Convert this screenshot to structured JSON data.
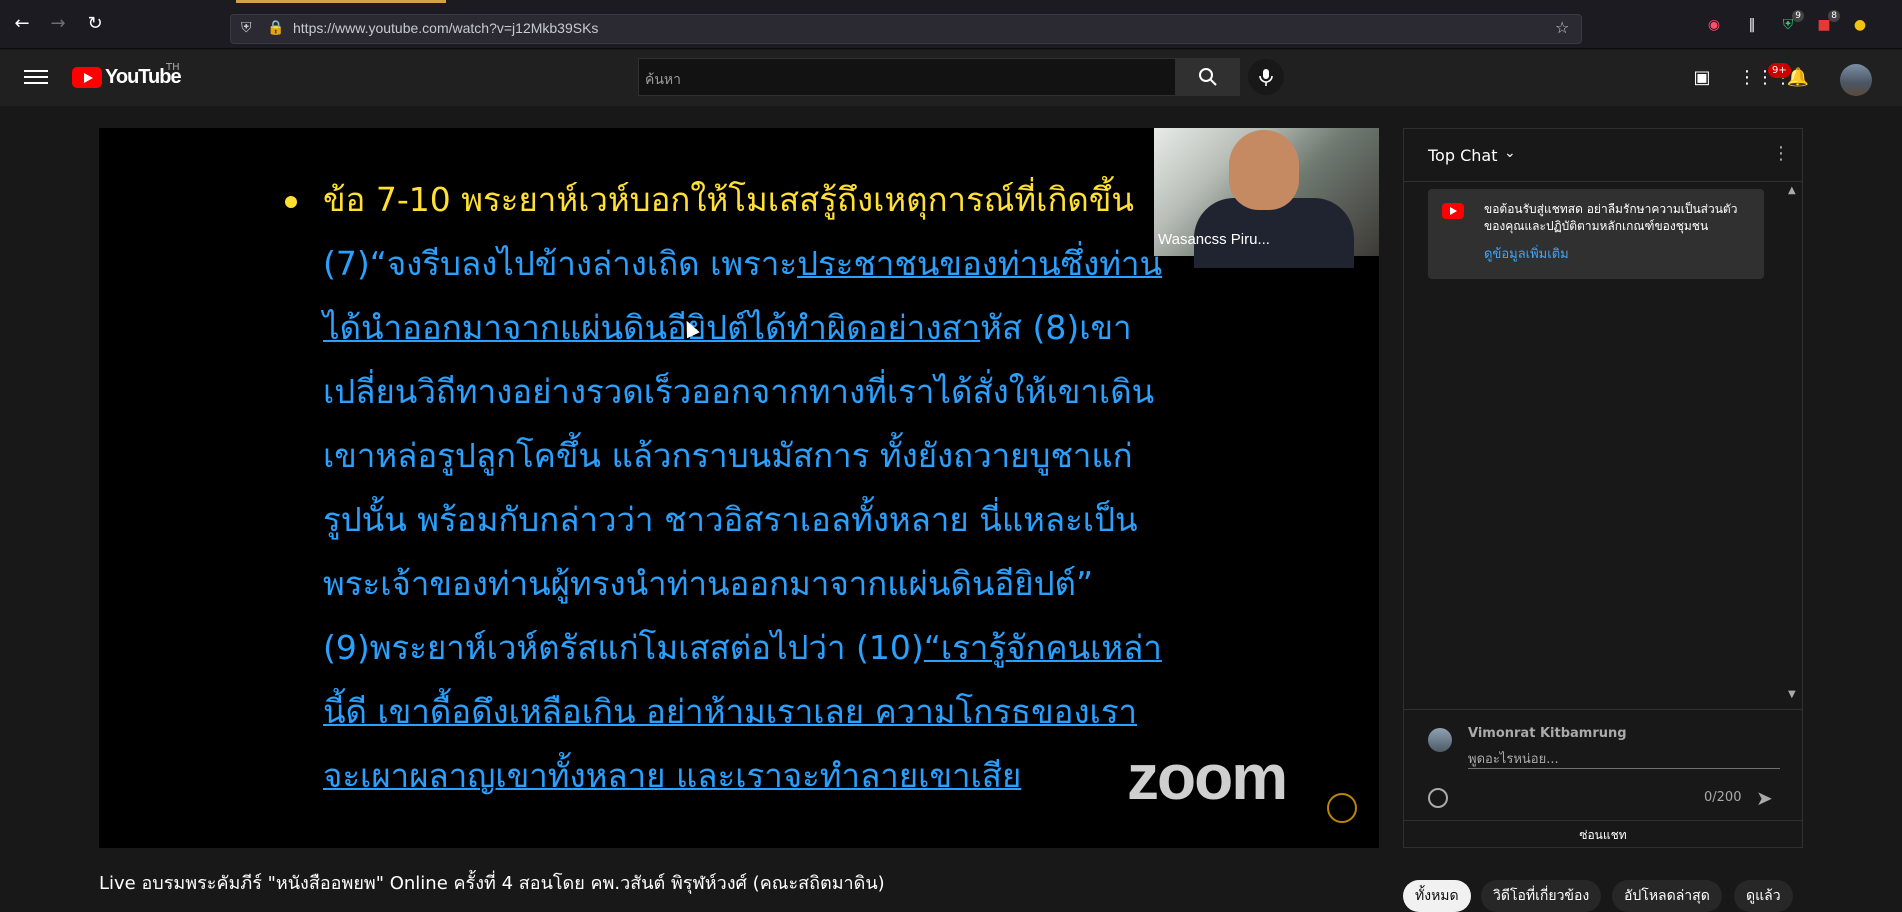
{
  "browser": {
    "url": "https://www.youtube.com/watch?v=j12Mkb39SKs",
    "back_icon": "back-arrow-icon",
    "forward_icon": "forward-arrow-icon",
    "reload_icon": "reload-icon",
    "bookmark_icon": "star-icon",
    "extensions": [
      {
        "name": "pocket-icon"
      },
      {
        "name": "library-icon"
      },
      {
        "name": "shield-extension-icon",
        "badge": "9"
      },
      {
        "name": "adblock-icon",
        "badge": "8"
      },
      {
        "name": "color-extension-icon"
      }
    ]
  },
  "youtube": {
    "logo_text": "YouTube",
    "country_code": "TH",
    "search_placeholder": "ค้นหา",
    "notification_badge": "9+",
    "brand_color": "#ff0000"
  },
  "slide": {
    "lines": [
      [
        {
          "t": "ข้อ 7-10 พระยาห์เวห์บอกให้โมเสสรู้ถึงเหตุการณ์ที่เกิดขึ้น",
          "c": "yellow"
        }
      ],
      [
        {
          "t": "(7)“จงรีบลงไปข้างล่างเถิด เพราะ",
          "c": ""
        },
        {
          "t": "ประชาชนของท่านซึ่งท่าน",
          "c": "u"
        }
      ],
      [
        {
          "t": "ได้นำออกมาจากแผ่นดินอียิปต์ได้ทำผิดอย่างสา",
          "c": "u"
        },
        {
          "t": "หัส (8)เขา",
          "c": ""
        }
      ],
      [
        {
          "t": "เปลี่ยนวิถีทางอย่างรวดเร็วออกจากทางที่เราได้สั่งให้เขาเดิน",
          "c": ""
        }
      ],
      [
        {
          "t": "เขาหล่อรูปลูกโคขึ้น แล้วกราบนมัสการ ทั้งยังถวายบูชาแก่",
          "c": ""
        }
      ],
      [
        {
          "t": "รูปนั้น พร้อมกับกล่าวว่า ชาวอิสราเอลทั้งหลาย นี่แหละเป็น",
          "c": ""
        }
      ],
      [
        {
          "t": "พระเจ้าของท่านผู้ทรงนำท่านออกมาจากแผ่นดินอียิปต์”",
          "c": ""
        }
      ],
      [
        {
          "t": "(9)พระยาห์เวห์ตรัสแก่โมเสสต่อไปว่า (10)",
          "c": ""
        },
        {
          "t": "“เรารู้จักคนเหล่า",
          "c": "u"
        }
      ],
      [
        {
          "t": "นี้ดี เขาดื้อดึงเหลือเกิน อย่าห้ามเราเลย ความโกรธของเรา",
          "c": "u"
        }
      ],
      [
        {
          "t": "จะเผาผลาญเขาทั้งหลาย และเราจะทำลายเขาเสีย",
          "c": "u"
        }
      ]
    ],
    "yellow_color": "#ffe033",
    "blue_color": "#2aa1ff",
    "participant_name": "Wasancss Piru...",
    "zoom_logo": "zoom"
  },
  "video": {
    "title": "Live อบรมพระคัมภีร์ \"หนังสืออพยพ\" Online ครั้งที่ 4 สอนโดย คพ.วสันต์ พิรุฬห์วงศ์ (คณะสถิตมาดิน)"
  },
  "chips": [
    {
      "label": "ทั้งหมด",
      "active": true
    },
    {
      "label": "วิดีโอที่เกี่ยวข้อง",
      "active": false
    },
    {
      "label": "อัปโหลดล่าสุด",
      "active": false
    },
    {
      "label": "ดูแล้ว",
      "active": false
    }
  ],
  "chat": {
    "title": "Top Chat",
    "notice_text": "ขอต้อนรับสู่แชทสด อย่าลืมรักษาความเป็นส่วนตัวของคุณและปฏิบัติตามหลักเกณฑ์ของชุมชน",
    "notice_link": "ดูข้อมูลเพิ่มเติม",
    "user_name": "Vimonrat Kitbamrung",
    "input_placeholder": "พูดอะไรหน่อย...",
    "char_count": "0/200",
    "hide_label": "ซ่อนแชท"
  }
}
